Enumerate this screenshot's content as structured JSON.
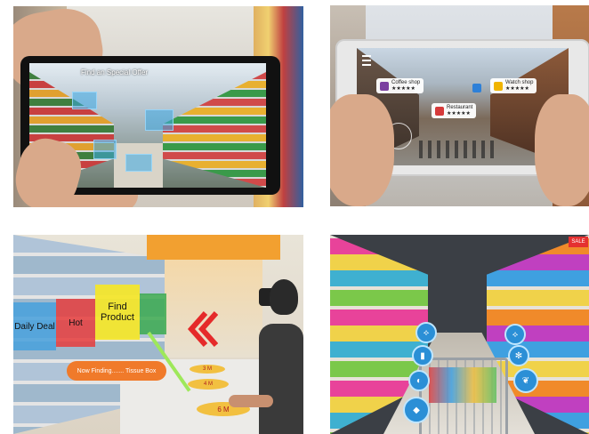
{
  "panel1": {
    "overlay_text": "Find an Special Offer"
  },
  "panel2": {
    "tags": [
      {
        "label": "Coffee shop",
        "rating": "★★★★★",
        "color": "#7b3fa0"
      },
      {
        "label": "Restaurant",
        "rating": "★★★★★",
        "color": "#d63a3a"
      },
      {
        "label": "Watch shop",
        "rating": "★★★★★",
        "color": "#f0b400"
      }
    ]
  },
  "panel3": {
    "labels": [
      "Daily Deal",
      "Hot",
      "Find Product"
    ],
    "finding_text": "Now Finding....... Tissue Box",
    "floor_markers": [
      "3 M",
      "4 M",
      "6 M"
    ]
  },
  "panel4": {
    "sale_tag": "SALE"
  }
}
